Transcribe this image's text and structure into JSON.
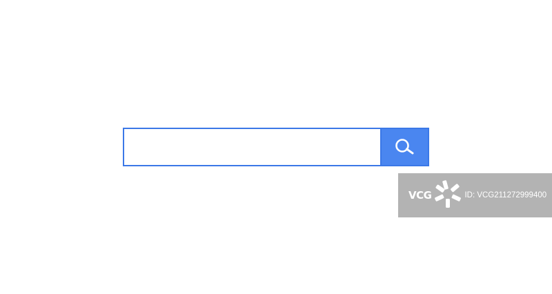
{
  "search": {
    "value": "",
    "placeholder": ""
  },
  "icons": {
    "search_button_icon": "magnifier-icon"
  },
  "watermark": {
    "brand": "VCG",
    "id_text": "ID: VCG211272999400"
  },
  "colors": {
    "accent": "#4a86f0",
    "border": "#3b78e7",
    "background": "#ffffff",
    "watermark_bg": "#969696"
  }
}
